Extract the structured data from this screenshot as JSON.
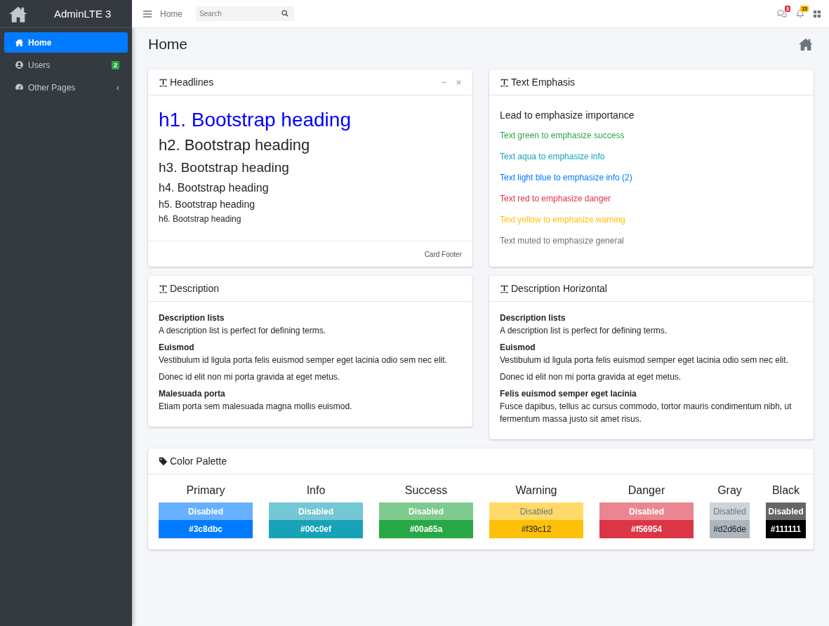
{
  "sidebar": {
    "brand": "AdminLTE 3",
    "items": [
      {
        "label": "Home",
        "selected": true
      },
      {
        "label": "Users",
        "selected": false,
        "badge": "2"
      },
      {
        "label": "Other Pages",
        "selected": false,
        "caret": "‹"
      }
    ]
  },
  "navbar": {
    "link": "Home",
    "search": {
      "placeholder": "Search"
    },
    "notifications": [
      {
        "badge": "3",
        "color": "#dc3545"
      },
      {
        "badge": "15",
        "color": "#ffc107"
      }
    ]
  },
  "page": {
    "title": "Home"
  },
  "headlines": {
    "title": "Headlines",
    "footer": "Card Footer",
    "items": [
      {
        "kind": "h1",
        "text": "h1. Bootstrap heading",
        "color": "#0000ff"
      },
      {
        "kind": "h2",
        "text": "h2. Bootstrap heading",
        "color": "#212529"
      },
      {
        "kind": "h3",
        "text": "h3. Bootstrap heading",
        "color": "#212529"
      },
      {
        "kind": "h4",
        "text": "h4. Bootstrap heading",
        "color": "#212529"
      },
      {
        "kind": "h5",
        "text": "h5. Bootstrap heading",
        "color": "#212529"
      },
      {
        "kind": "h6",
        "text": "h6. Bootstrap heading",
        "color": "#212529"
      }
    ]
  },
  "emphasis": {
    "title": "Text Emphasis",
    "items": [
      {
        "kind": "lead",
        "text": "Lead to emphasize importance",
        "color": "#212529"
      },
      {
        "kind": "text",
        "text": "Text green to emphasize success",
        "color": "#28a745"
      },
      {
        "kind": "text",
        "text": "Text aqua to emphasize info",
        "color": "#17a2b8"
      },
      {
        "kind": "text",
        "text": "Text light blue to emphasize info (2)",
        "color": "#007bff"
      },
      {
        "kind": "text",
        "text": "Text red to emphasize danger",
        "color": "#dc3545"
      },
      {
        "kind": "text",
        "text": "Text yellow to emphasize warning",
        "color": "#ffc107"
      },
      {
        "kind": "text",
        "text": "Text muted to emphasize general",
        "color": "#6c757d"
      }
    ]
  },
  "descriptions": [
    {
      "title": "Description",
      "entries": [
        {
          "term": "Description lists",
          "details": [
            "A description list is perfect for defining terms."
          ]
        },
        {
          "term": "Euismod",
          "details": [
            "Vestibulum id ligula porta felis euismod semper eget lacinia odio sem nec elit.",
            "Donec id elit non mi porta gravida at eget metus."
          ]
        },
        {
          "term": "Malesuada porta",
          "details": [
            "Etiam porta sem malesuada magna mollis euismod."
          ]
        }
      ]
    },
    {
      "title": "Description Horizontal",
      "entries": [
        {
          "term": "Description lists",
          "details": [
            "A description list is perfect for defining terms."
          ]
        },
        {
          "term": "Euismod",
          "details": [
            "Vestibulum id ligula porta felis euismod semper eget lacinia odio sem nec elit.",
            "Donec id elit non mi porta gravida at eget metus."
          ]
        },
        {
          "term": "Felis euismod semper eget lacinia",
          "details": [
            "Fusce dapibus, tellus ac cursus commodo, tortor mauris condimentum nibh, ut fermentum massa justo sit amet risus."
          ]
        }
      ]
    }
  ],
  "palette": {
    "title": "Color Palette",
    "colors": [
      {
        "name": "Primary",
        "disabled_label": "Disabled",
        "code": "#3c8dbc",
        "color": "#007bff"
      },
      {
        "name": "Info",
        "disabled_label": "Disabled",
        "code": "#00c0ef",
        "color": "#17a2b8"
      },
      {
        "name": "Success",
        "disabled_label": "Disabled",
        "code": "#00a65a",
        "color": "#28a745"
      },
      {
        "name": "Warning",
        "disabled_label": "Disabled",
        "code": "#f39c12",
        "color": "#ffc107"
      },
      {
        "name": "Danger",
        "disabled_label": "Disabled",
        "code": "#f56954",
        "color": "#dc3545"
      },
      {
        "name": "Gray",
        "disabled_label": "Disabled",
        "code": "#d2d6de",
        "color": "#adb5bd"
      },
      {
        "name": "Black",
        "disabled_label": "Disabled",
        "code": "#111111",
        "color": "#000000"
      }
    ]
  }
}
